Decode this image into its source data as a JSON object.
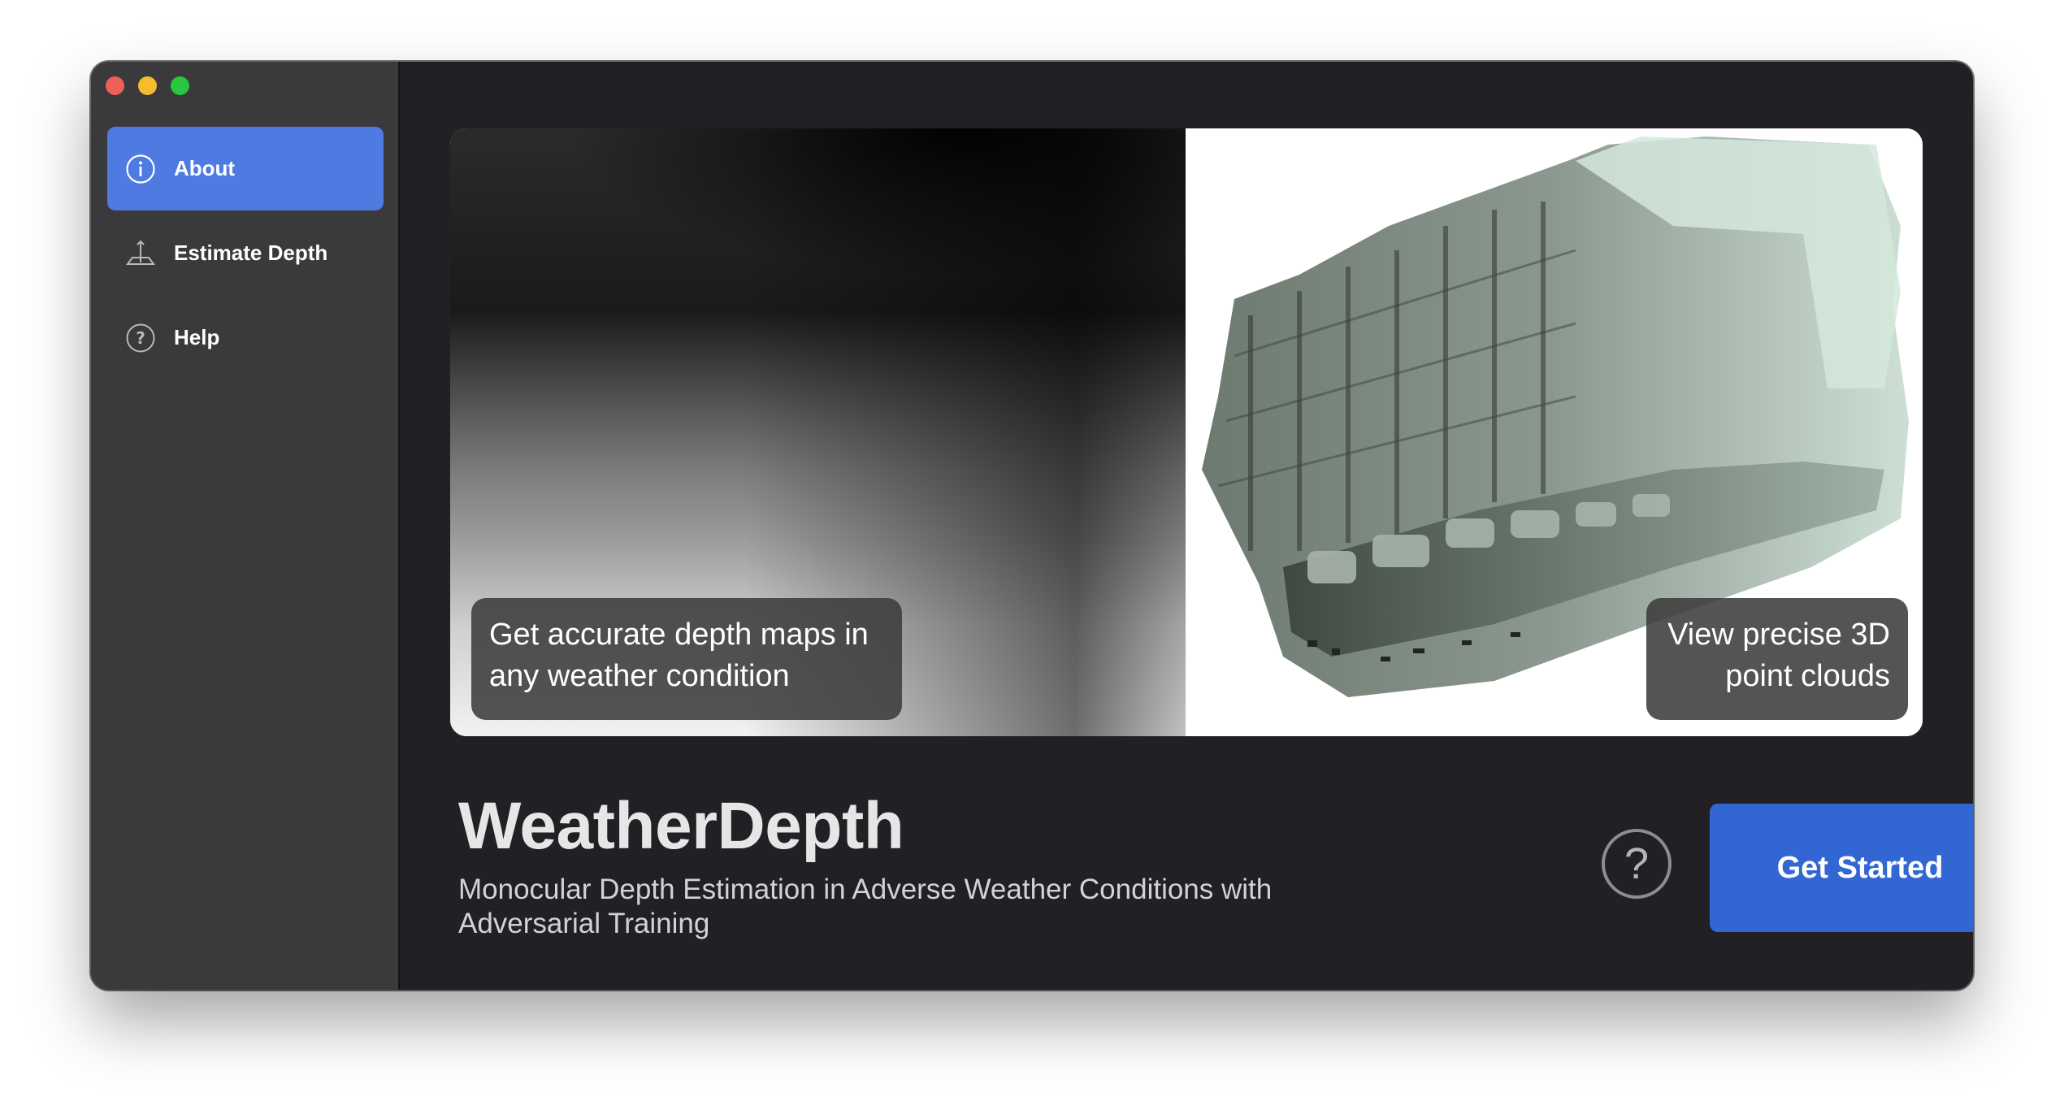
{
  "sidebar": {
    "items": [
      {
        "label": "About",
        "icon": "info-icon",
        "active": true
      },
      {
        "label": "Estimate Depth",
        "icon": "ruler-depth-icon",
        "active": false
      },
      {
        "label": "Help",
        "icon": "question-icon",
        "active": false
      }
    ]
  },
  "hero": {
    "left_caption_line1": "Get accurate depth maps in",
    "left_caption_line2": "any weather condition",
    "right_caption_line1": "View precise 3D",
    "right_caption_line2": "point clouds"
  },
  "app": {
    "title": "WeatherDepth",
    "subtitle_line1": "Monocular Depth Estimation in Adverse Weather Conditions with",
    "subtitle_line2": "Adversarial Training"
  },
  "actions": {
    "help_symbol": "?",
    "get_started_label": "Get Started"
  },
  "colors": {
    "accent": "#4f7ae2",
    "button": "#3266d2",
    "background": "#221f25",
    "sidebar": "#3a393c"
  }
}
